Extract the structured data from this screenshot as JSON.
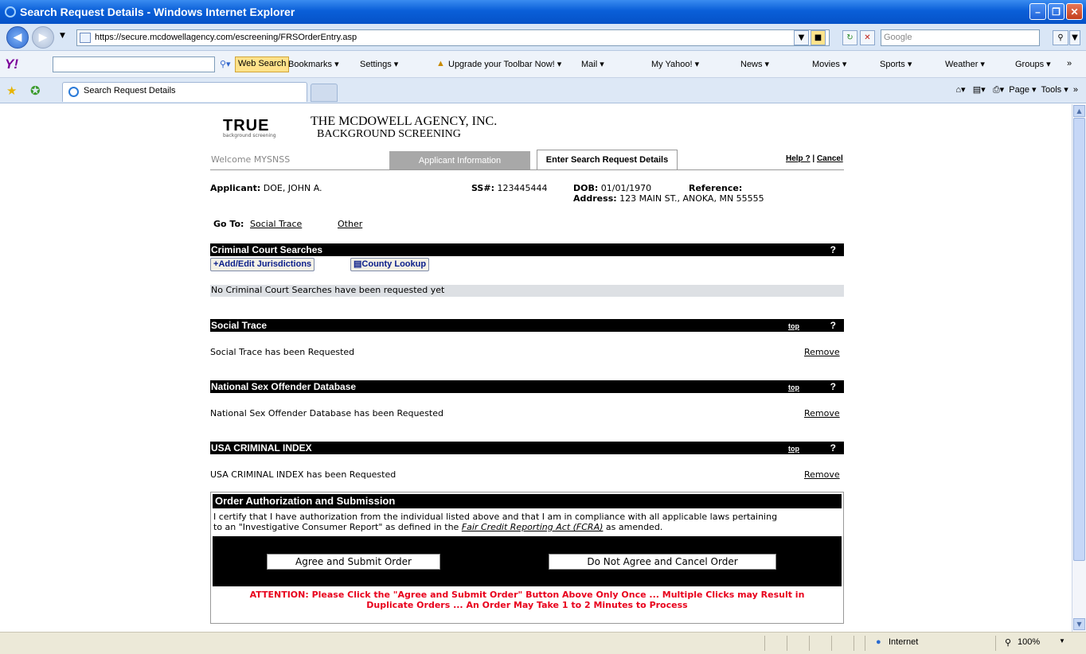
{
  "window": {
    "title": "Search Request Details - Windows Internet Explorer"
  },
  "address": {
    "url": "https://secure.mcdowellagency.com/escreening/FRSOrderEntry.asp",
    "search_placeholder": "Google"
  },
  "toolbar": {
    "web_search": "Web Search",
    "items": [
      "Bookmarks ▾",
      "Settings ▾",
      "Upgrade your Toolbar Now! ▾",
      "Mail ▾",
      "My Yahoo! ▾",
      "News ▾",
      "Movies ▾",
      "Sports ▾",
      "Weather ▾",
      "Groups ▾"
    ]
  },
  "tabs": {
    "active": "Search Request Details"
  },
  "commands": {
    "page": "Page ▾",
    "tools": "Tools ▾"
  },
  "header": {
    "agency_line1": "THE MCDOWELL AGENCY, INC.",
    "agency_line2": "BACKGROUND SCREENING",
    "logo": "TRUE",
    "logo_sub": "background screening"
  },
  "nav": {
    "welcome": "Welcome MYSNSS",
    "tab_applicant": "Applicant Information",
    "tab_search": "Enter Search Request Details",
    "help": "Help ?",
    "sep": "|",
    "cancel": "Cancel"
  },
  "applicant": {
    "label": "Applicant:",
    "name": "DOE, JOHN A.",
    "ss_label": "SS#:",
    "ss": "123445444",
    "dob_label": "DOB:",
    "dob": "01/01/1970",
    "ref_label": "Reference:",
    "addr_label": "Address:",
    "address": "123 MAIN ST., ANOKA, MN 55555"
  },
  "goto": {
    "label": "Go To:",
    "link1": "Social Trace",
    "link2": "Other"
  },
  "criminal": {
    "title": "Criminal Court Searches",
    "help": "?",
    "add_btn": "Add/Edit Jurisdictions",
    "lookup_btn": "County Lookup",
    "empty": "No Criminal Court Searches have been requested yet"
  },
  "social": {
    "title": "Social Trace",
    "top": "top",
    "help": "?",
    "status": "Social Trace has been Requested",
    "remove": "Remove"
  },
  "nsod": {
    "title": "National Sex Offender Database",
    "top": "top",
    "help": "?",
    "status": "National Sex Offender Database has been Requested",
    "remove": "Remove"
  },
  "usa": {
    "title": "USA CRIMINAL INDEX",
    "top": "top",
    "help": "?",
    "status": "USA CRIMINAL INDEX has been Requested",
    "remove": "Remove"
  },
  "auth": {
    "title": "Order Authorization and Submission",
    "text1": "I certify that I have authorization from the individual listed above and that I am in compliance with all applicable laws pertaining",
    "text2a": "to an \"Investigative Consumer Report\" as defined in the ",
    "fcra": "Fair Credit Reporting Act (FCRA)",
    "text2b": " as amended.",
    "agree": "Agree and Submit Order",
    "disagree": "Do Not Agree and Cancel Order",
    "attention1": "ATTENTION: Please Click the \"Agree and Submit Order\" Button Above Only Once ... Multiple Clicks may Result in",
    "attention2": "Duplicate Orders ... An Order May Take 1 to 2 Minutes to Process"
  },
  "status": {
    "zone": "Internet",
    "zoom": "100%"
  },
  "colors": {
    "attention": "#e8001c",
    "titlebar": "#0a5fd8",
    "bar": "#000000"
  }
}
